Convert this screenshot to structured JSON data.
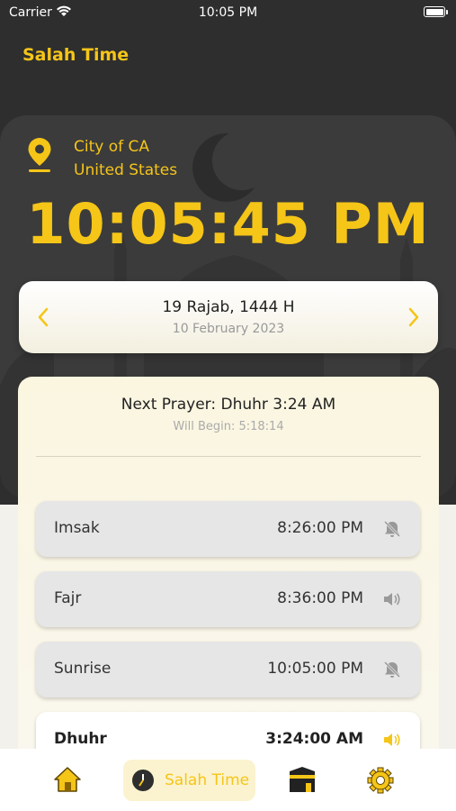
{
  "status_bar": {
    "carrier": "Carrier",
    "time": "10:05 PM"
  },
  "header": {
    "title": "Salah Time"
  },
  "location": {
    "city": "City of CA",
    "country": "United States"
  },
  "clock": {
    "time": "10:05:45 PM"
  },
  "date": {
    "hijri": "19 Rajab, 1444 H",
    "gregorian": "10 February 2023"
  },
  "next_prayer": {
    "title": "Next Prayer: Dhuhr 3:24 AM",
    "countdown": "Will Begin: 5:18:14"
  },
  "prayers": [
    {
      "name": "Imsak",
      "time": "8:26:00 PM",
      "icon": "bell-off-icon"
    },
    {
      "name": "Fajr",
      "time": "8:36:00 PM",
      "icon": "speaker-icon"
    },
    {
      "name": "Sunrise",
      "time": "10:05:00 PM",
      "icon": "bell-off-icon"
    },
    {
      "name": "Dhuhr",
      "time": "3:24:00 AM",
      "icon": "speaker-icon"
    }
  ],
  "tabs": [
    {
      "icon": "home-icon"
    },
    {
      "icon": "clock-icon",
      "label": "Salah Time"
    },
    {
      "icon": "kaaba-icon"
    },
    {
      "icon": "gear-icon"
    }
  ],
  "colors": {
    "accent": "#f5c518",
    "dark_bg": "#2e2e2e",
    "card_bg": "#3b3b3b"
  }
}
